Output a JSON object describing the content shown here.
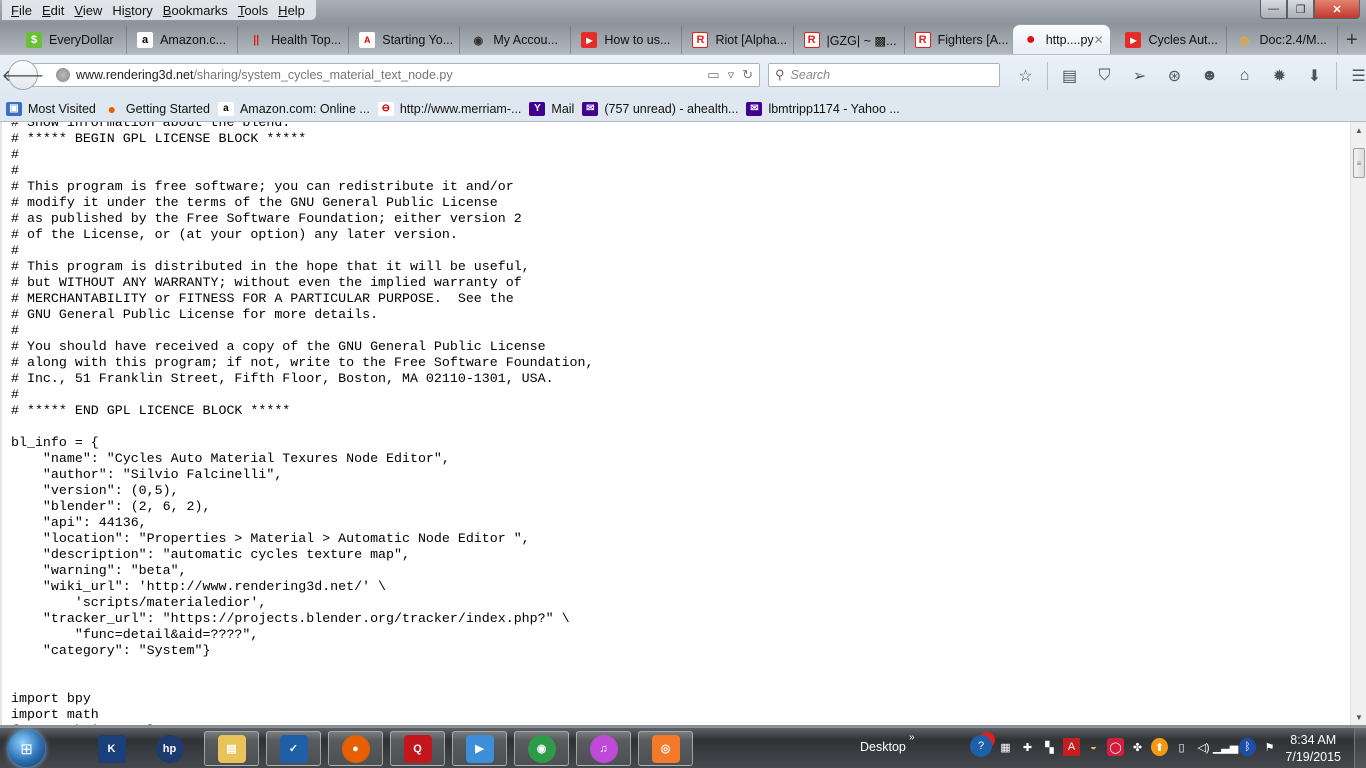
{
  "window": {
    "menu": [
      "File",
      "Edit",
      "View",
      "History",
      "Bookmarks",
      "Tools",
      "Help"
    ],
    "controls": {
      "minimize": "—",
      "restore": "❐",
      "close": "✕"
    }
  },
  "tabs": [
    {
      "label": "EveryDollar",
      "icon": "everydollar-icon",
      "icon_color": "#6cbf3a",
      "glyph": "$"
    },
    {
      "label": "Amazon.c...",
      "icon": "amazon-icon",
      "icon_color": "#ffffff",
      "glyph": "a"
    },
    {
      "label": "Health Top...",
      "icon": "health-icon",
      "icon_color": "#e02020",
      "glyph": "||"
    },
    {
      "label": "Starting Yo...",
      "icon": "aip-icon",
      "icon_color": "#ffffff",
      "glyph": "A"
    },
    {
      "label": "My Accou...",
      "icon": "account-icon",
      "icon_color": "#333333",
      "glyph": "◉"
    },
    {
      "label": "How to us...",
      "icon": "youtube-icon",
      "icon_color": "#e52d27",
      "glyph": "▶"
    },
    {
      "label": "Riot [Alpha...",
      "icon": "roblox-icon",
      "icon_color": "#ffffff",
      "glyph": "R"
    },
    {
      "label": "|GZG| ~ ▩...",
      "icon": "roblox-icon",
      "icon_color": "#ffffff",
      "glyph": "R"
    },
    {
      "label": "Fighters [A...",
      "icon": "roblox-icon",
      "icon_color": "#ffffff",
      "glyph": "R"
    },
    {
      "label": "http....py",
      "icon": "red-ball-icon",
      "icon_color": "#e01010",
      "glyph": "●",
      "active": true
    },
    {
      "label": "Cycles Aut...",
      "icon": "youtube-icon",
      "icon_color": "#e52d27",
      "glyph": "▶"
    },
    {
      "label": "Doc:2.4/M...",
      "icon": "blender-icon",
      "icon_color": "#f5a623",
      "glyph": "◎"
    }
  ],
  "new_tab": "+",
  "tab_close": "✕",
  "navbar": {
    "url_domain": "www.rendering3d.net",
    "url_path": "/sharing/system_cycles_material_text_node.py",
    "search_placeholder": "Search",
    "icons": [
      "bookmark-star-icon",
      "reading-list-icon",
      "pocket-icon",
      "send-icon",
      "addon-icon",
      "chat-icon",
      "home-icon",
      "settings-icon",
      "download-icon",
      "menu-icon"
    ]
  },
  "bookmarks": [
    {
      "label": "Most Visited",
      "icon": "most-visited-icon",
      "color": "#3a6fc4",
      "glyph": "▣"
    },
    {
      "label": "Getting Started",
      "icon": "firefox-icon",
      "color": "#e66000",
      "glyph": "●"
    },
    {
      "label": "Amazon.com: Online ...",
      "icon": "amazon-icon",
      "color": "#ffffff",
      "glyph": "a"
    },
    {
      "label": "http://www.merriam-...",
      "icon": "merriam-webster-icon",
      "color": "#ffffff",
      "glyph": "⊖"
    },
    {
      "label": "Mail",
      "icon": "yahoo-icon",
      "color": "#400090",
      "glyph": "Y"
    },
    {
      "label": "(757 unread) - ahealth...",
      "icon": "yahoo-mail-icon",
      "color": "#400090",
      "glyph": "✉"
    },
    {
      "label": "lbmtripp1174 - Yahoo ...",
      "icon": "yahoo-mail-icon",
      "color": "#400090",
      "glyph": "✉"
    }
  ],
  "code_lines": [
    "# Show information about the blend.",
    "# ***** BEGIN GPL LICENSE BLOCK *****",
    "#",
    "#",
    "# This program is free software; you can redistribute it and/or",
    "# modify it under the terms of the GNU General Public License",
    "# as published by the Free Software Foundation; either version 2",
    "# of the License, or (at your option) any later version.",
    "#",
    "# This program is distributed in the hope that it will be useful,",
    "# but WITHOUT ANY WARRANTY; without even the implied warranty of",
    "# MERCHANTABILITY or FITNESS FOR A PARTICULAR PURPOSE.  See the",
    "# GNU General Public License for more details.",
    "#",
    "# You should have received a copy of the GNU General Public License",
    "# along with this program; if not, write to the Free Software Foundation,",
    "# Inc., 51 Franklin Street, Fifth Floor, Boston, MA 02110-1301, USA.",
    "#",
    "# ***** END GPL LICENCE BLOCK *****",
    "",
    "bl_info = {",
    "    \"name\": \"Cycles Auto Material Texures Node Editor\",",
    "    \"author\": \"Silvio Falcinelli\",",
    "    \"version\": (0,5),",
    "    \"blender\": (2, 6, 2),",
    "    \"api\": 44136,",
    "    \"location\": \"Properties > Material > Automatic Node Editor \",",
    "    \"description\": \"automatic cycles texture map\",",
    "    \"warning\": \"beta\",",
    "    \"wiki_url\": 'http://www.rendering3d.net/' \\",
    "        'scripts/materialedior',",
    "    \"tracker_url\": \"https://projects.blender.org/tracker/index.php?\" \\",
    "        \"func=detail&aid=????\",",
    "    \"category\": \"System\"}",
    "",
    "",
    "import bpy",
    "import math",
    "from math import log"
  ],
  "taskbar": {
    "pinned": [
      {
        "name": "kindle-icon",
        "color": "#1b3f78",
        "glyph": "K"
      },
      {
        "name": "hp-icon",
        "color": "#1d3b6e",
        "glyph": "hp"
      },
      {
        "name": "file-explorer-icon",
        "color": "#e8c35a",
        "glyph": "▤"
      },
      {
        "name": "checkmark-app-icon",
        "color": "#1f5fa8",
        "glyph": "✓"
      },
      {
        "name": "firefox-icon",
        "color": "#e66000",
        "glyph": "●"
      },
      {
        "name": "quicken-icon",
        "color": "#c4171d",
        "glyph": "Q"
      },
      {
        "name": "media-player-icon",
        "color": "#3c8fd8",
        "glyph": "▶"
      },
      {
        "name": "chrome-icon",
        "color": "#2e9b48",
        "glyph": "◉"
      },
      {
        "name": "itunes-icon",
        "color": "#c04ad8",
        "glyph": "♫"
      },
      {
        "name": "blender-icon",
        "color": "#f5792a",
        "glyph": "◎"
      }
    ],
    "desktop_label": "Desktop",
    "overflow": "»",
    "tray": [
      {
        "name": "help-alert-icon",
        "glyph": "?"
      },
      {
        "name": "windows-icon",
        "glyph": "▦"
      },
      {
        "name": "network-monitor-icon",
        "glyph": "✚"
      },
      {
        "name": "app-tray-icon",
        "glyph": "▚"
      },
      {
        "name": "adobe-icon",
        "glyph": "A"
      },
      {
        "name": "weather-icon",
        "glyph": "◒"
      },
      {
        "name": "security-icon",
        "glyph": "◯"
      },
      {
        "name": "dropbox-icon",
        "glyph": "✤"
      },
      {
        "name": "update-icon",
        "glyph": "⬆"
      },
      {
        "name": "power-icon",
        "glyph": "▯"
      },
      {
        "name": "volume-icon",
        "glyph": "◁)"
      },
      {
        "name": "signal-icon",
        "glyph": "▁▃▅"
      },
      {
        "name": "bluetooth-icon",
        "glyph": "ᛒ"
      },
      {
        "name": "action-center-icon",
        "glyph": "⚑"
      }
    ],
    "time": "8:34 AM",
    "date": "7/19/2015"
  }
}
